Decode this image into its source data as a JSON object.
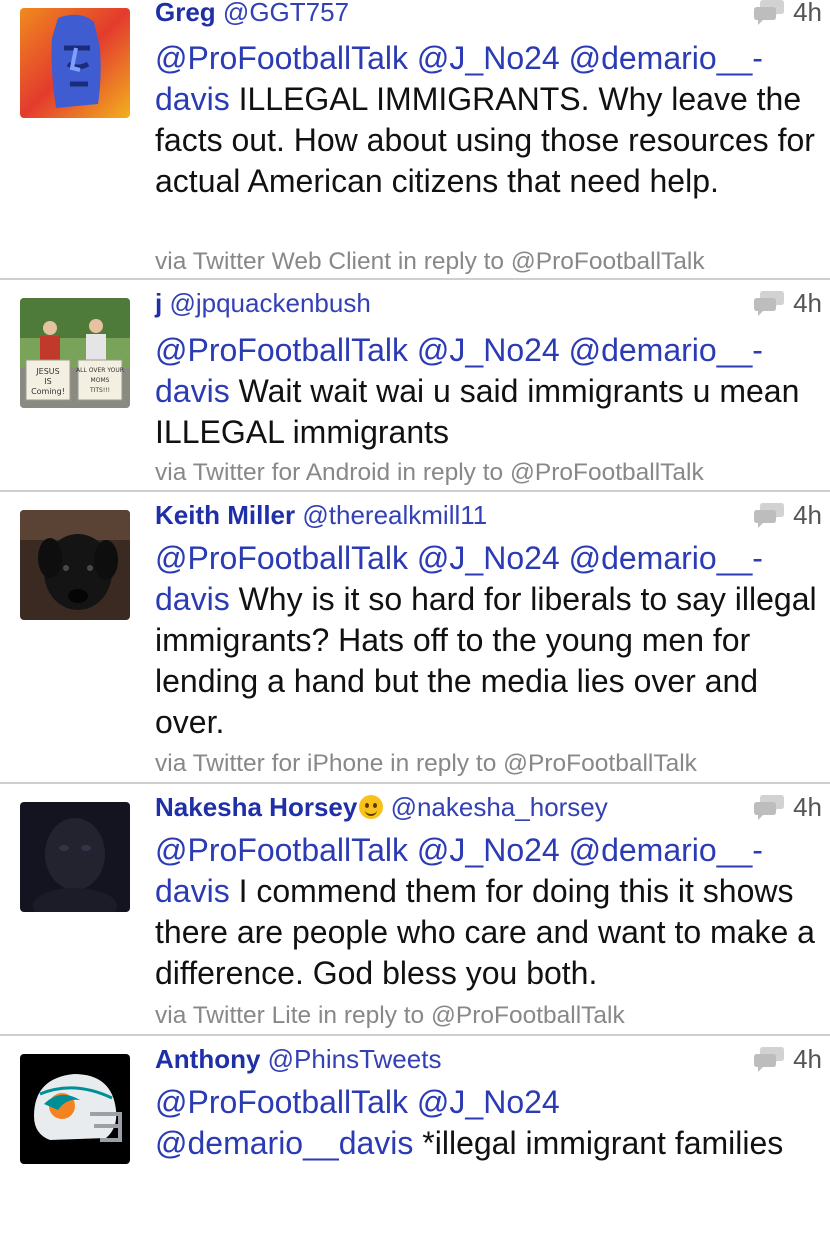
{
  "tweets": [
    {
      "display_name": "Greg",
      "handle": "@GGT757",
      "time": "4h",
      "mentions": [
        "@ProFootballTalk",
        "@J_No24",
        "@demario__-",
        "davis"
      ],
      "text": " ILLEGAL IMMIGRANTS. Why leave the facts out. How about using those resources for actual American citizens that need help.",
      "via_prefix": "via ",
      "client": "Twitter Web Client",
      "reply_prefix": " in reply to ",
      "reply_to": "@ProFootballTalk",
      "avatar_icon": "moai-statue-avatar"
    },
    {
      "display_name": "j",
      "handle": "@jpquackenbush",
      "time": "4h",
      "mentions": [
        "@ProFootballTalk",
        "@J_No24",
        "@demario__-",
        "davis"
      ],
      "text": " Wait wait wai u said immigrants u mean ILLEGAL immigrants",
      "via_prefix": "via ",
      "client": "Twitter for Android",
      "reply_prefix": " in reply to ",
      "reply_to": "@ProFootballTalk",
      "avatar_icon": "protest-signs-avatar",
      "avatar_sign_left": "JESUS IS Coming!",
      "avatar_sign_right": "ALL OVER YOUR MOMS TITS!!!"
    },
    {
      "display_name": "Keith Miller",
      "handle": "@therealkmill11",
      "time": "4h",
      "mentions": [
        "@ProFootballTalk",
        "@J_No24",
        "@demario__-",
        "davis"
      ],
      "text": " Why is it so hard for liberals to say illegal immigrants? Hats off to the young men for lending a hand but the media lies over and over.",
      "via_prefix": "via ",
      "client": "Twitter for iPhone",
      "reply_prefix": " in reply to ",
      "reply_to": "@ProFootballTalk",
      "avatar_icon": "black-dog-avatar"
    },
    {
      "display_name": "Nakesha Horsey",
      "name_emoji": "smiling-face-emoji",
      "handle": "@nakesha_horsey",
      "time": "4h",
      "mentions": [
        "@ProFootballTalk",
        "@J_No24",
        "@demario__-",
        "davis"
      ],
      "text": " I commend them for doing this it shows there are people who care and want to make a difference. God bless you both.",
      "via_prefix": "via ",
      "client": "Twitter Lite",
      "reply_prefix": " in reply to ",
      "reply_to": "@ProFootballTalk",
      "avatar_icon": "dark-portrait-avatar"
    },
    {
      "display_name": "Anthony",
      "handle": "@PhinsTweets",
      "time": "4h",
      "mentions": [
        "@ProFootballTalk",
        "@J_No24",
        "@demario__davis"
      ],
      "text": " *illegal immigrant families",
      "avatar_icon": "dolphins-helmet-avatar"
    }
  ],
  "colors": {
    "mention": "#2b3bb3",
    "name": "#1f2fa8",
    "footer": "#888888",
    "divider": "#cfcfcf",
    "reply_icon": "#c4c4c4"
  },
  "icons": {
    "reply": "speech-bubbles-icon"
  }
}
